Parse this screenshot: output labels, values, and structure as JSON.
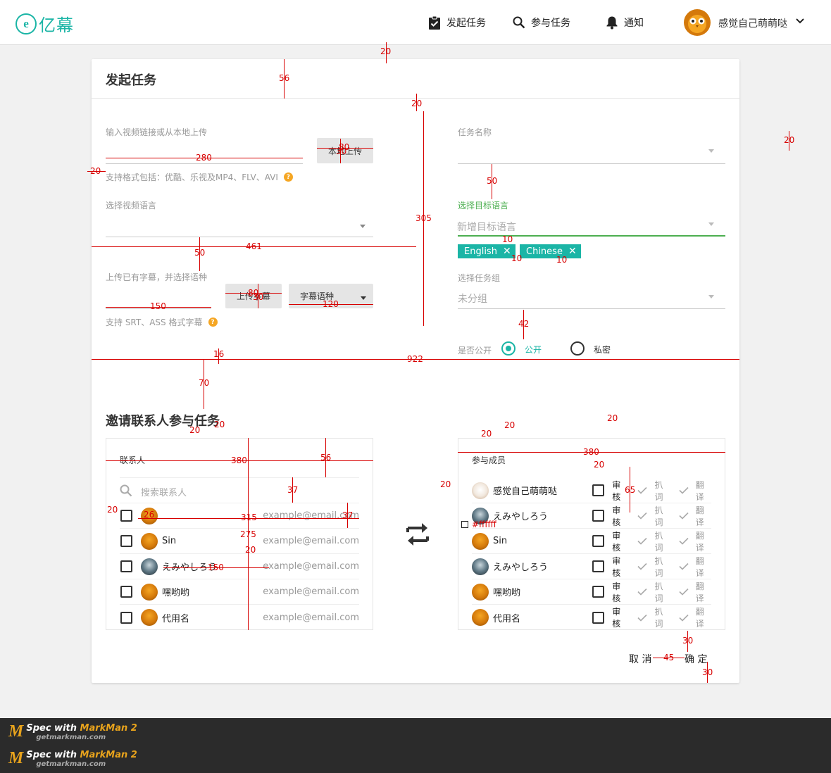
{
  "header": {
    "logo_text": "亿幕",
    "nav": [
      {
        "label": "发起任务",
        "icon": "clipboard-check-icon"
      },
      {
        "label": "参与任务",
        "icon": "search-icon"
      },
      {
        "label": "通知",
        "icon": "bell-icon"
      }
    ],
    "user_name": "感觉自己萌萌哒"
  },
  "form": {
    "title": "发起任务",
    "video_link_label": "输入视频链接或从本地上传",
    "local_upload_button": "本地上传",
    "formats_hint": "支持格式包括：优酷、乐视及MP4、FLV、AVI",
    "video_language_label": "选择视频语言",
    "subtitle_label": "上传已有字幕，并选择语种",
    "upload_subtitle_button": "上传字幕",
    "subtitle_language_select": "字幕语种",
    "subtitle_formats_hint": "支持 SRT、ASS 格式字幕",
    "task_name_label": "任务名称",
    "target_language_label": "选择目标语言",
    "target_language_placeholder": "新增目标语言",
    "tags": [
      "English",
      "Chinese"
    ],
    "task_group_label": "选择任务组",
    "task_group_value": "未分组",
    "public_label": "是否公开",
    "public_option": "公开",
    "private_option": "私密"
  },
  "invite": {
    "title": "邀请联系人参与任务",
    "contacts_title": "联系人",
    "search_placeholder": "搜索联系人",
    "contacts": [
      {
        "name": "",
        "email": "example@email.com",
        "avatar": "owl"
      },
      {
        "name": "Sin",
        "email": "example@email.com",
        "avatar": "owl"
      },
      {
        "name": "えみやしろう",
        "email": "example@email.com",
        "avatar": "dark"
      },
      {
        "name": "嘿哟哟",
        "email": "example@email.com",
        "avatar": "owl"
      },
      {
        "name": "代用名",
        "email": "example@email.com",
        "avatar": "owl"
      }
    ],
    "members_title": "参与成员",
    "members": [
      {
        "name": "感觉自己萌萌哒",
        "avatar": "cat"
      },
      {
        "name": "えみやしろう",
        "avatar": "dark"
      },
      {
        "name": "Sin",
        "avatar": "owl"
      },
      {
        "name": "えみやしろう",
        "avatar": "dark"
      },
      {
        "name": "嘿哟哟",
        "avatar": "owl"
      },
      {
        "name": "代用名",
        "avatar": "owl"
      }
    ],
    "role_review": "审核",
    "role_capture": "扒词",
    "role_translate": "翻译",
    "cancel_button": "取 消",
    "confirm_button": "确 定"
  },
  "annotations": {
    "color_note": "#ffffff",
    "values": [
      "20",
      "56",
      "20",
      "305",
      "80",
      "30",
      "280",
      "20",
      "50",
      "461",
      "50",
      "80",
      "30",
      "150",
      "120",
      "10",
      "10",
      "10",
      "20",
      "42",
      "16",
      "922",
      "70",
      "20",
      "20",
      "20",
      "20",
      "380",
      "56",
      "380",
      "20",
      "20",
      "37",
      "37",
      "26",
      "315",
      "275",
      "20",
      "20",
      "65",
      "150",
      "30",
      "45",
      "30",
      "20"
    ]
  },
  "footer": {
    "brand_prefix": "Spec with ",
    "brand_name": "MarkMan 2",
    "brand_url": "getmarkman.com"
  },
  "colors": {
    "accent": "#1bb5a6",
    "measure": "#d70000",
    "hint": "#f5a623",
    "active_label": "#4caf50"
  }
}
